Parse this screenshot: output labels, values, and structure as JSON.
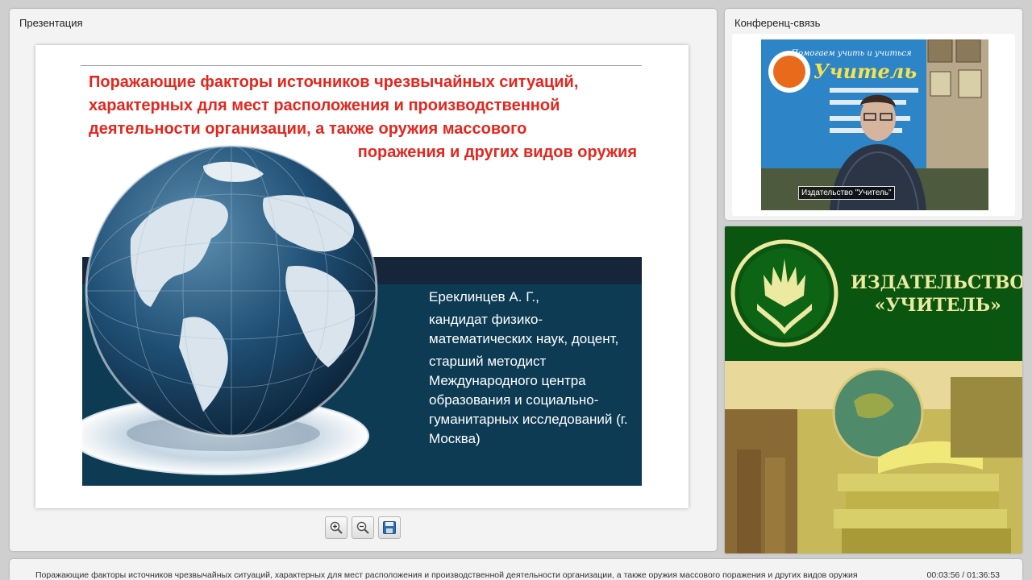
{
  "presentation": {
    "panel_title": "Презентация",
    "slide": {
      "title_lines": [
        "Поражающие факторы источников чрезвычайных ситуаций,",
        "характерных для мест расположения и производственной",
        "деятельности организации, а также оружия массового",
        "поражения и других видов оружия"
      ],
      "author": [
        "Ереклинцев А. Г.,",
        "кандидат физико-математических наук, доцент,",
        "старший методист Международного центра образования и социально-гуманитарных исследований (г. Москва)"
      ]
    },
    "toolbar": {
      "zoom_in_icon": "zoom-in-icon",
      "zoom_out_icon": "zoom-out-icon",
      "save_icon": "save-icon"
    }
  },
  "conference": {
    "panel_title": "Конференц-связь",
    "video_caption": "Издательство \"Учитель\"",
    "banner_text": "Помогаем учить и учиться",
    "banner_brand": "Учитель"
  },
  "brand": {
    "line1": "ИЗДАТЕЛЬСТВО",
    "line2": "«УЧИТЕЛЬ»"
  },
  "status": {
    "title": "Поражающие факторы источников чрезвычайных ситуаций, характерных для мест расположения и производственной деятельности организации, а также оружия массового поражения и других видов оружия",
    "time": "00:03:56 / 01:36:53"
  },
  "colors": {
    "slide_title": "#e5261e",
    "slide_band": "#0d3b54",
    "brand_green": "#0a5510",
    "brand_gold": "#ece9a0"
  }
}
